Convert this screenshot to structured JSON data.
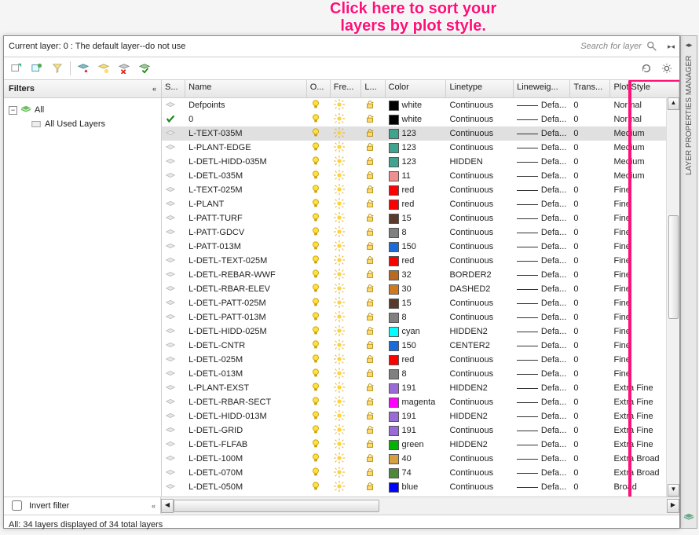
{
  "annotation_line1": "Click here to sort your",
  "annotation_line2": "layers by plot style.",
  "current_layer": "Current layer: 0 : The default layer--do not use",
  "search_placeholder": "Search for layer",
  "filters_title": "Filters",
  "tree": {
    "all": "All",
    "used": "All Used Layers"
  },
  "invert_label": "Invert filter",
  "status_text": "All: 34 layers displayed of 34 total layers",
  "side_title": "LAYER PROPERTIES MANAGER",
  "headers": {
    "status": "S...",
    "name": "Name",
    "on": "O...",
    "freeze": "Fre...",
    "lock": "L...",
    "color": "Color",
    "linetype": "Linetype",
    "lineweight": "Lineweig...",
    "trans": "Trans...",
    "plotstyle": "Plot Style"
  },
  "rows": [
    {
      "status": "inactive",
      "name": "Defpoints",
      "color": "white",
      "swatch": "#000000",
      "linetype": "Continuous",
      "lw": "Defa...",
      "trans": "0",
      "pstyle": "Normal"
    },
    {
      "status": "current",
      "name": "0",
      "color": "white",
      "swatch": "#000000",
      "linetype": "Continuous",
      "lw": "Defa...",
      "trans": "0",
      "pstyle": "Normal"
    },
    {
      "status": "inactive",
      "name": "L-TEXT-035M",
      "sel": true,
      "color": "123",
      "swatch": "#3fa38d",
      "linetype": "Continuous",
      "lw": "Defa...",
      "trans": "0",
      "pstyle": "Medium"
    },
    {
      "status": "inactive",
      "name": "L-PLANT-EDGE",
      "color": "123",
      "swatch": "#3fa38d",
      "linetype": "Continuous",
      "lw": "Defa...",
      "trans": "0",
      "pstyle": "Medium"
    },
    {
      "status": "inactive",
      "name": "L-DETL-HIDD-035M",
      "color": "123",
      "swatch": "#3fa38d",
      "linetype": "HIDDEN",
      "lw": "Defa...",
      "trans": "0",
      "pstyle": "Medium"
    },
    {
      "status": "inactive",
      "name": "L-DETL-035M",
      "color": "11",
      "swatch": "#f08f8f",
      "linetype": "Continuous",
      "lw": "Defa...",
      "trans": "0",
      "pstyle": "Medium"
    },
    {
      "status": "inactive",
      "name": "L-TEXT-025M",
      "color": "red",
      "swatch": "#ff0000",
      "linetype": "Continuous",
      "lw": "Defa...",
      "trans": "0",
      "pstyle": "Fine"
    },
    {
      "status": "inactive",
      "name": "L-PLANT",
      "color": "red",
      "swatch": "#ff0000",
      "linetype": "Continuous",
      "lw": "Defa...",
      "trans": "0",
      "pstyle": "Fine"
    },
    {
      "status": "inactive",
      "name": "L-PATT-TURF",
      "color": "15",
      "swatch": "#5a3a2a",
      "linetype": "Continuous",
      "lw": "Defa...",
      "trans": "0",
      "pstyle": "Fine"
    },
    {
      "status": "inactive",
      "name": "L-PATT-GDCV",
      "color": "8",
      "swatch": "#808080",
      "linetype": "Continuous",
      "lw": "Defa...",
      "trans": "0",
      "pstyle": "Fine"
    },
    {
      "status": "inactive",
      "name": "L-PATT-013M",
      "color": "150",
      "swatch": "#1b6cd6",
      "linetype": "Continuous",
      "lw": "Defa...",
      "trans": "0",
      "pstyle": "Fine"
    },
    {
      "status": "inactive",
      "name": "L-DETL-TEXT-025M",
      "color": "red",
      "swatch": "#ff0000",
      "linetype": "Continuous",
      "lw": "Defa...",
      "trans": "0",
      "pstyle": "Fine"
    },
    {
      "status": "inactive",
      "name": "L-DETL-REBAR-WWF",
      "color": "32",
      "swatch": "#b86a20",
      "linetype": "BORDER2",
      "lw": "Defa...",
      "trans": "0",
      "pstyle": "Fine"
    },
    {
      "status": "inactive",
      "name": "L-DETL-RBAR-ELEV",
      "color": "30",
      "swatch": "#d07a20",
      "linetype": "DASHED2",
      "lw": "Defa...",
      "trans": "0",
      "pstyle": "Fine"
    },
    {
      "status": "inactive",
      "name": "L-DETL-PATT-025M",
      "color": "15",
      "swatch": "#5a3a2a",
      "linetype": "Continuous",
      "lw": "Defa...",
      "trans": "0",
      "pstyle": "Fine"
    },
    {
      "status": "inactive",
      "name": "L-DETL-PATT-013M",
      "color": "8",
      "swatch": "#808080",
      "linetype": "Continuous",
      "lw": "Defa...",
      "trans": "0",
      "pstyle": "Fine"
    },
    {
      "status": "inactive",
      "name": "L-DETL-HIDD-025M",
      "color": "cyan",
      "swatch": "#00ffff",
      "linetype": "HIDDEN2",
      "lw": "Defa...",
      "trans": "0",
      "pstyle": "Fine"
    },
    {
      "status": "inactive",
      "name": "L-DETL-CNTR",
      "color": "150",
      "swatch": "#1b6cd6",
      "linetype": "CENTER2",
      "lw": "Defa...",
      "trans": "0",
      "pstyle": "Fine"
    },
    {
      "status": "inactive",
      "name": "L-DETL-025M",
      "color": "red",
      "swatch": "#ff0000",
      "linetype": "Continuous",
      "lw": "Defa...",
      "trans": "0",
      "pstyle": "Fine"
    },
    {
      "status": "inactive",
      "name": "L-DETL-013M",
      "color": "8",
      "swatch": "#808080",
      "linetype": "Continuous",
      "lw": "Defa...",
      "trans": "0",
      "pstyle": "Fine"
    },
    {
      "status": "inactive",
      "name": "L-PLANT-EXST",
      "color": "191",
      "swatch": "#9a6ad6",
      "linetype": "HIDDEN2",
      "lw": "Defa...",
      "trans": "0",
      "pstyle": "Extra Fine"
    },
    {
      "status": "inactive",
      "name": "L-DETL-RBAR-SECT",
      "color": "magenta",
      "swatch": "#ff00ff",
      "linetype": "Continuous",
      "lw": "Defa...",
      "trans": "0",
      "pstyle": "Extra Fine"
    },
    {
      "status": "inactive",
      "name": "L-DETL-HIDD-013M",
      "color": "191",
      "swatch": "#9a6ad6",
      "linetype": "HIDDEN2",
      "lw": "Defa...",
      "trans": "0",
      "pstyle": "Extra Fine"
    },
    {
      "status": "inactive",
      "name": "L-DETL-GRID",
      "color": "191",
      "swatch": "#9a6ad6",
      "linetype": "Continuous",
      "lw": "Defa...",
      "trans": "0",
      "pstyle": "Extra Fine"
    },
    {
      "status": "inactive",
      "name": "L-DETL-FLFAB",
      "color": "green",
      "swatch": "#00b400",
      "linetype": "HIDDEN2",
      "lw": "Defa...",
      "trans": "0",
      "pstyle": "Extra Fine"
    },
    {
      "status": "inactive",
      "name": "L-DETL-100M",
      "color": "40",
      "swatch": "#d6a040",
      "linetype": "Continuous",
      "lw": "Defa...",
      "trans": "0",
      "pstyle": "Extra Broad"
    },
    {
      "status": "inactive",
      "name": "L-DETL-070M",
      "color": "74",
      "swatch": "#4a8a3a",
      "linetype": "Continuous",
      "lw": "Defa...",
      "trans": "0",
      "pstyle": "Extra Broad"
    },
    {
      "status": "inactive",
      "name": "L-DETL-050M",
      "color": "blue",
      "swatch": "#0000ff",
      "linetype": "Continuous",
      "lw": "Defa...",
      "trans": "0",
      "pstyle": "Broad"
    }
  ]
}
